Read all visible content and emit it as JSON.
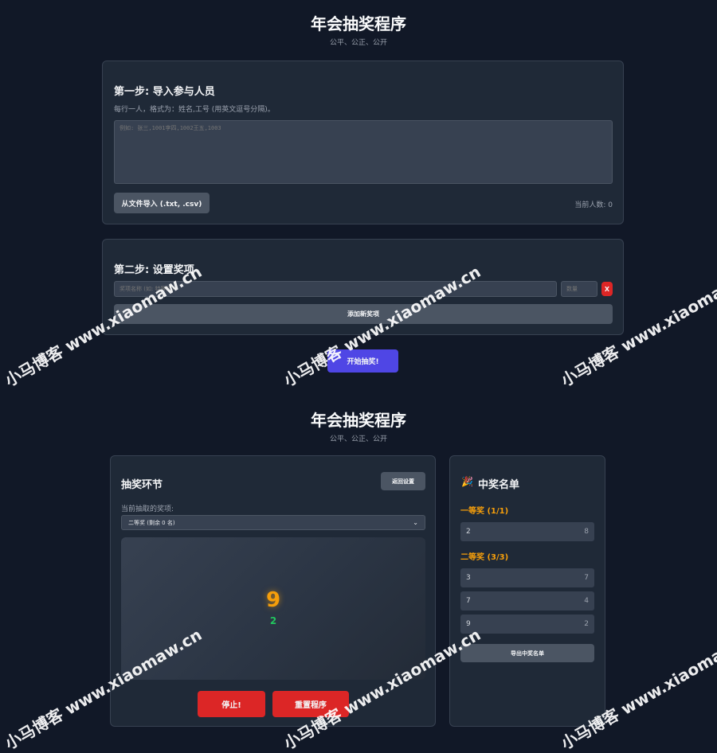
{
  "app": {
    "title": "年会抽奖程序",
    "subtitle": "公平、公正、公开"
  },
  "step1": {
    "heading": "第一步: 导入参与人员",
    "hint": "每行一人，格式为：姓名,工号 (用英文逗号分隔)。",
    "textarea_placeholder": "例如: 张三,1001李四,1002王五,1003",
    "import_button": "从文件导入 (.txt, .csv)",
    "count_label": "当前人数: 0"
  },
  "step2": {
    "heading": "第二步: 设置奖项",
    "prize_name_placeholder": "奖项名称 (如: 特等奖)",
    "count_placeholder": "数量",
    "remove_label": "X",
    "add_button": "添加新奖项"
  },
  "start_button": "开始抽奖!",
  "draw": {
    "heading": "抽奖环节",
    "back_button": "返回设置",
    "current_prize_label": "当前抽取的奖项:",
    "selected_prize": "二等奖 (剩余 0 名)",
    "display_number": "9",
    "display_id": "2",
    "stop_button": "停止!",
    "reset_button": "重置程序"
  },
  "winners": {
    "heading": "中奖名单",
    "icon": "party-popper-icon",
    "groups": [
      {
        "title": "一等奖 (1/1)",
        "rows": [
          {
            "name": "2",
            "id": "8"
          }
        ]
      },
      {
        "title": "二等奖 (3/3)",
        "rows": [
          {
            "name": "3",
            "id": "7"
          },
          {
            "name": "7",
            "id": "4"
          },
          {
            "name": "9",
            "id": "2"
          }
        ]
      }
    ],
    "export_button": "导出中奖名单"
  },
  "watermark": "小马博客 www.xiaomaw.cn",
  "colors": {
    "accent": "#4f46e5",
    "danger": "#dc2626",
    "prize": "#f59e0b",
    "number": "#f59e0b",
    "id": "#22c55e"
  }
}
